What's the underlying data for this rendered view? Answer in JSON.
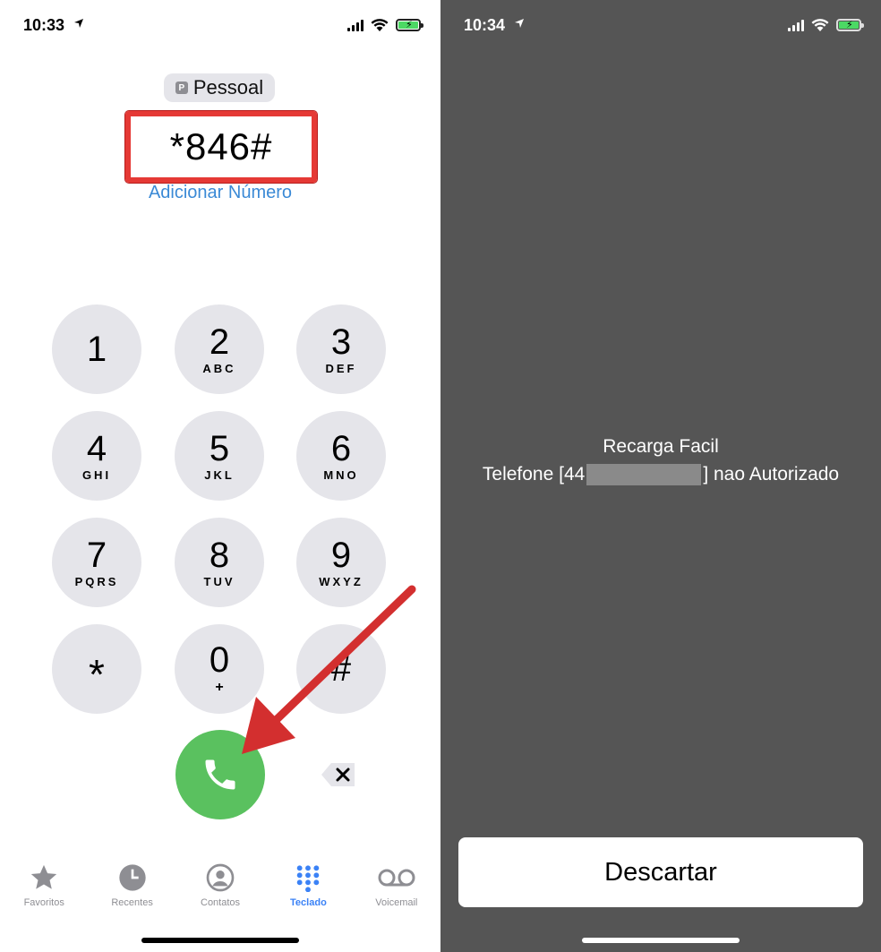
{
  "left_screen": {
    "status_bar": {
      "time": "10:33"
    },
    "sim_label": "Pessoal",
    "sim_icon_letter": "P",
    "dialed_number": "*846#",
    "add_number_link": "Adicionar Número",
    "keypad": [
      {
        "digit": "1",
        "letters": ""
      },
      {
        "digit": "2",
        "letters": "ABC"
      },
      {
        "digit": "3",
        "letters": "DEF"
      },
      {
        "digit": "4",
        "letters": "GHI"
      },
      {
        "digit": "5",
        "letters": "JKL"
      },
      {
        "digit": "6",
        "letters": "MNO"
      },
      {
        "digit": "7",
        "letters": "PQRS"
      },
      {
        "digit": "8",
        "letters": "TUV"
      },
      {
        "digit": "9",
        "letters": "WXYZ"
      },
      {
        "digit": "*",
        "letters": ""
      },
      {
        "digit": "0",
        "letters": "+"
      },
      {
        "digit": "#",
        "letters": ""
      }
    ],
    "tabs": [
      {
        "label": "Favoritos",
        "icon": "star-icon",
        "active": false
      },
      {
        "label": "Recentes",
        "icon": "clock-icon",
        "active": false
      },
      {
        "label": "Contatos",
        "icon": "person-icon",
        "active": false
      },
      {
        "label": "Teclado",
        "icon": "keypad-icon",
        "active": true
      },
      {
        "label": "Voicemail",
        "icon": "voicemail-icon",
        "active": false
      }
    ],
    "highlight_color": "#e53935",
    "call_color": "#5ac15f",
    "accent_color": "#3b82f6"
  },
  "right_screen": {
    "status_bar": {
      "time": "10:34"
    },
    "message_title": "Recarga Facil",
    "message_prefix": "Telefone [44",
    "message_suffix": "] nao Autorizado",
    "dismiss_button": "Descartar",
    "background_color": "#555555"
  }
}
